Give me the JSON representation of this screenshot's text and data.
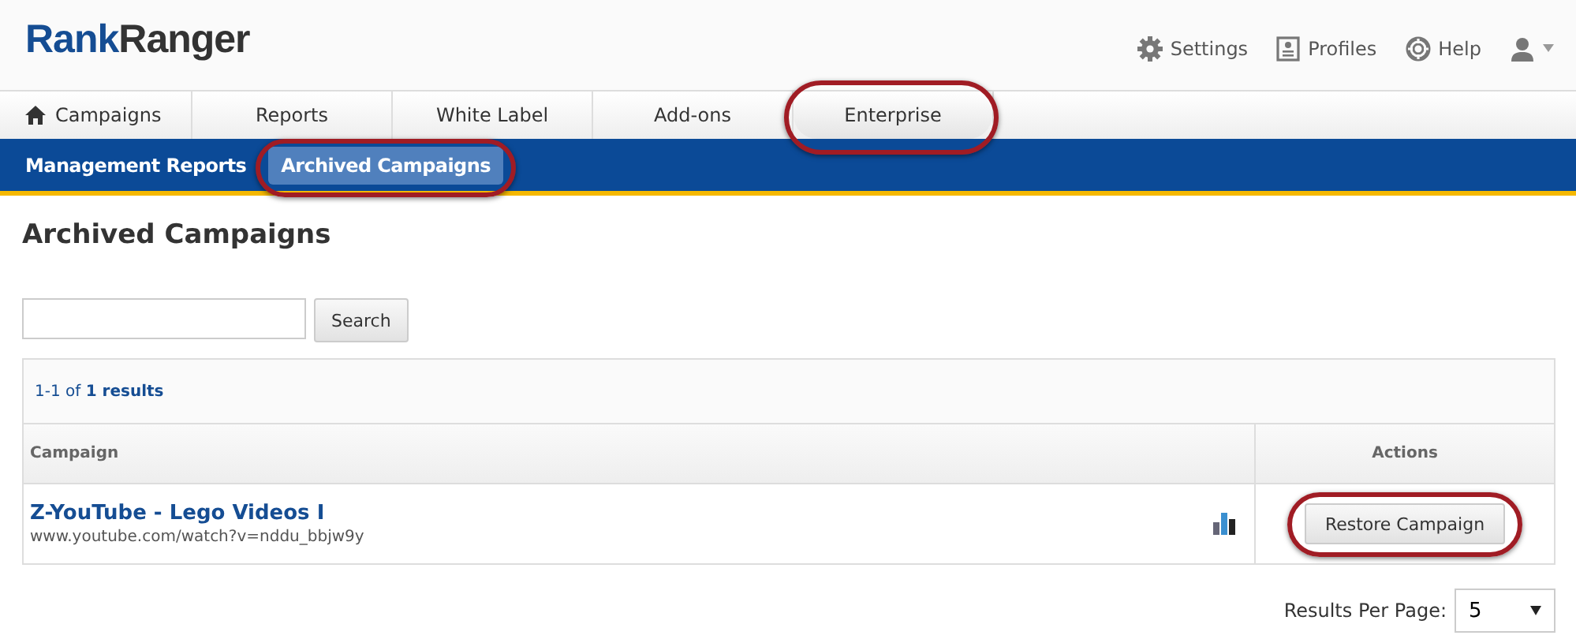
{
  "logo": {
    "part_1": "Rank",
    "part_2": "Ranger"
  },
  "top_links": [
    {
      "kind": "gear",
      "label": "Settings"
    },
    {
      "kind": "profile",
      "label": "Profiles"
    },
    {
      "kind": "help",
      "label": "Help"
    },
    {
      "kind": "user"
    }
  ],
  "nav_tabs": [
    {
      "label": "Campaigns",
      "home_icon": true,
      "highlighted": false
    },
    {
      "label": "Reports",
      "home_icon": false,
      "highlighted": false
    },
    {
      "label": "White Label",
      "home_icon": false,
      "highlighted": false
    },
    {
      "label": "Add-ons",
      "home_icon": false,
      "highlighted": false
    },
    {
      "label": "Enterprise",
      "home_icon": false,
      "highlighted": true
    }
  ],
  "sub_nav": [
    {
      "label": "Management Reports",
      "selected": false,
      "highlighted": false
    },
    {
      "label": "Archived Campaigns",
      "selected": true,
      "highlighted": true
    }
  ],
  "page_title": "Archived Campaigns",
  "search": {
    "button": "Search"
  },
  "table": {
    "summary": "1-1 of **1 results**",
    "columns": [
      "Campaign",
      "Actions"
    ],
    "rows": [
      {
        "name": "Z-YouTube - Lego Videos I",
        "url": "www.youtube.com/watch?v=nddu_bbjw9y",
        "action": "Restore Campaign",
        "action_highlighted": true
      }
    ]
  },
  "pagination": {
    "label": "Results Per Page:",
    "value": "5"
  }
}
